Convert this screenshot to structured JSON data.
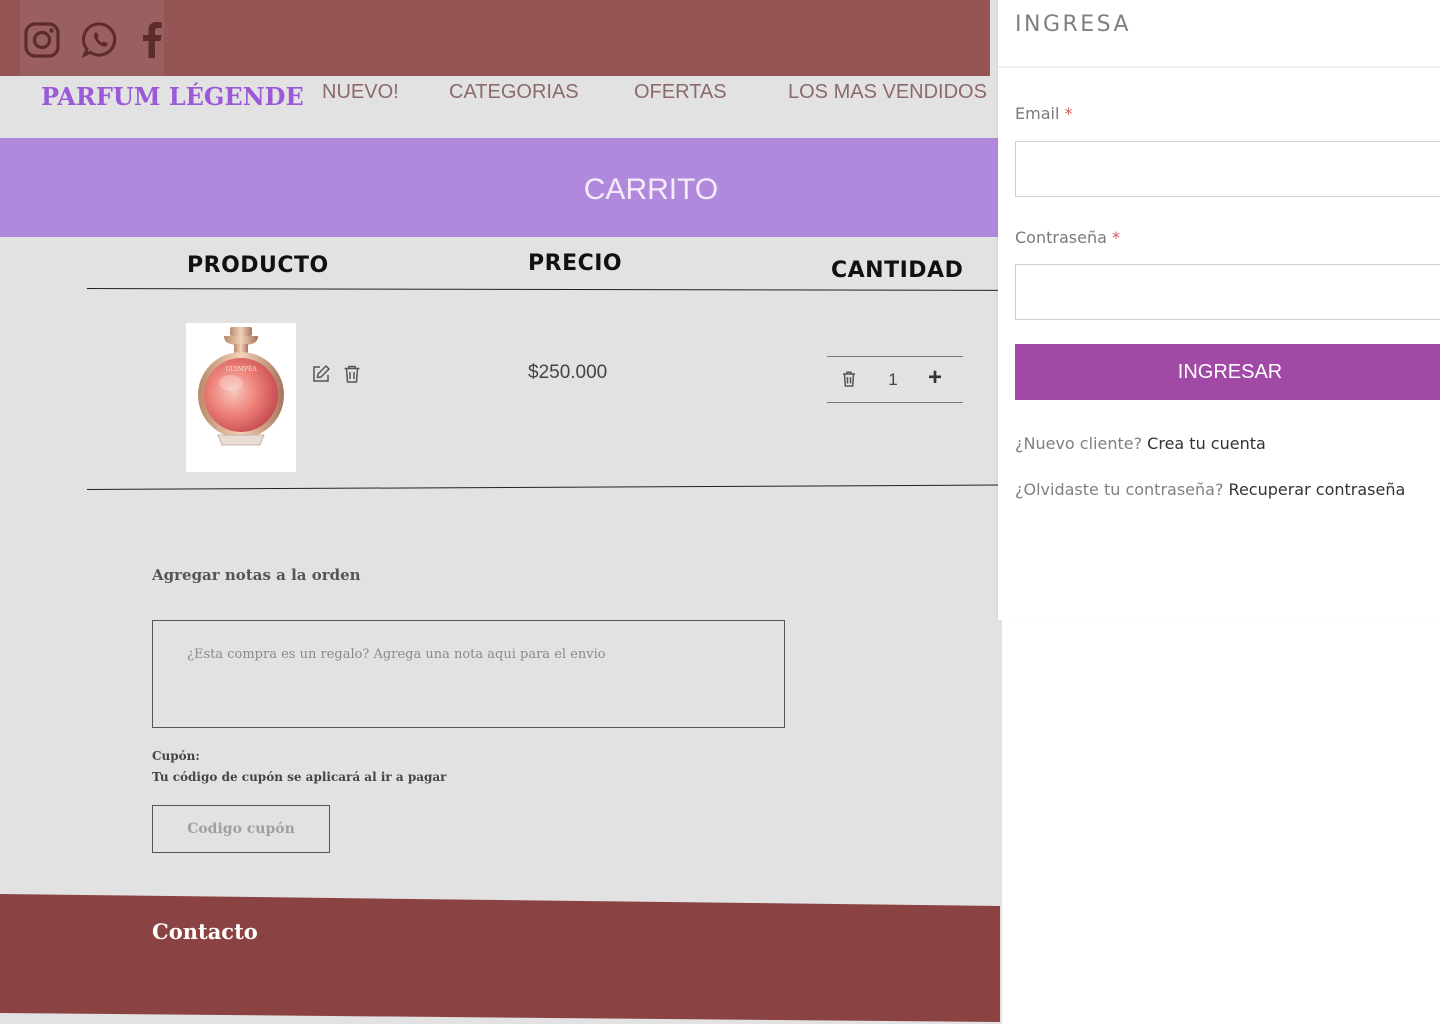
{
  "brand": "PARFUM LÉGENDE",
  "social": [
    "instagram-icon",
    "whatsapp-icon",
    "facebook-icon"
  ],
  "nav": {
    "nuevo": "NUEVO!",
    "categorias": "CATEGORIAS",
    "ofertas": "OFERTAS",
    "vendidos": "LOS MAS VENDIDOS"
  },
  "banner": {
    "title": "CARRITO"
  },
  "cart": {
    "headers": {
      "product": "PRODUCTO",
      "price": "PRECIO",
      "quantity": "CANTIDAD"
    },
    "item": {
      "image_label": "OLYMPÉA",
      "price": "$250.000",
      "quantity": "1"
    }
  },
  "notes": {
    "label": "Agregar notas a la orden",
    "placeholder": "¿Esta compra es un regalo? Agrega una nota aqui para el envio"
  },
  "coupon": {
    "label": "Cupón:",
    "help": "Tu código de cupón se aplicará al ir a pagar",
    "placeholder": "Codigo cupón"
  },
  "footer": {
    "title": "Contacto"
  },
  "login": {
    "title": "INGRESA",
    "email_label": "Email",
    "password_label": "Contraseña",
    "required_mark": "*",
    "submit": "INGRESAR",
    "new_customer_text": "¿Nuevo cliente?",
    "new_customer_link": "Crea tu cuenta",
    "forgot_text": "¿Olvidaste tu contraseña?",
    "forgot_link": "Recuperar contraseña"
  },
  "colors": {
    "topbar": "#955555",
    "brand": "#9b59d9",
    "banner": "#b089dc",
    "footer": "#8b4242",
    "login_button": "#a14aa5"
  }
}
